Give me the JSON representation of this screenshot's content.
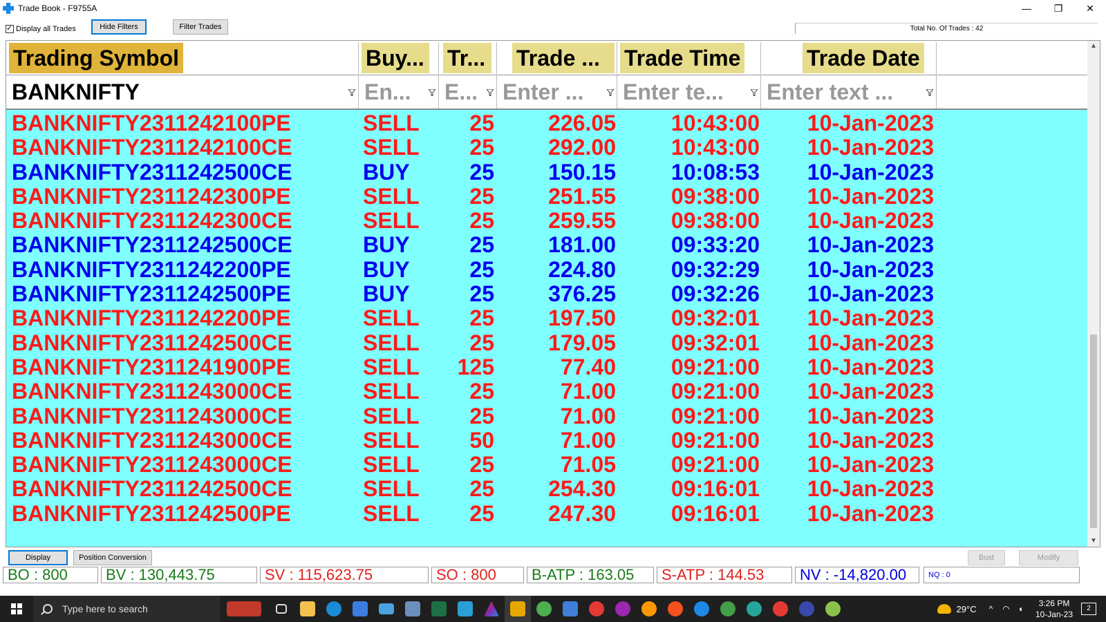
{
  "window": {
    "title": "Trade Book - F9755A",
    "minimize": "—",
    "restore": "❐",
    "close": "✕"
  },
  "toolbar": {
    "display_all_label": "Display all Trades",
    "hide_filters": "Hide Filters",
    "filter_trades": "Filter Trades",
    "total_trades": "Total No. Of Trades : 42"
  },
  "columns": [
    {
      "header": "Trading Symbol",
      "filter": "BANKNIFTY",
      "filter_is_value": true
    },
    {
      "header": "Buy...",
      "filter": "En...",
      "filter_is_value": false
    },
    {
      "header": "Tr...",
      "filter": "E...",
      "filter_is_value": false
    },
    {
      "header": "Trade ...",
      "filter": "Enter ...",
      "filter_is_value": false
    },
    {
      "header": "Trade Time",
      "filter": "Enter te...",
      "filter_is_value": false
    },
    {
      "header": "Trade Date",
      "filter": "Enter text ...",
      "filter_is_value": false
    }
  ],
  "trades": [
    {
      "symbol": "BANKNIFTY2311242100PE",
      "side": "SELL",
      "qty": "25",
      "price": "226.05",
      "time": "10:43:00",
      "date": "10-Jan-2023"
    },
    {
      "symbol": "BANKNIFTY2311242100CE",
      "side": "SELL",
      "qty": "25",
      "price": "292.00",
      "time": "10:43:00",
      "date": "10-Jan-2023"
    },
    {
      "symbol": "BANKNIFTY2311242500CE",
      "side": "BUY",
      "qty": "25",
      "price": "150.15",
      "time": "10:08:53",
      "date": "10-Jan-2023"
    },
    {
      "symbol": "BANKNIFTY2311242300PE",
      "side": "SELL",
      "qty": "25",
      "price": "251.55",
      "time": "09:38:00",
      "date": "10-Jan-2023"
    },
    {
      "symbol": "BANKNIFTY2311242300CE",
      "side": "SELL",
      "qty": "25",
      "price": "259.55",
      "time": "09:38:00",
      "date": "10-Jan-2023"
    },
    {
      "symbol": "BANKNIFTY2311242500CE",
      "side": "BUY",
      "qty": "25",
      "price": "181.00",
      "time": "09:33:20",
      "date": "10-Jan-2023"
    },
    {
      "symbol": "BANKNIFTY2311242200PE",
      "side": "BUY",
      "qty": "25",
      "price": "224.80",
      "time": "09:32:29",
      "date": "10-Jan-2023"
    },
    {
      "symbol": "BANKNIFTY2311242500PE",
      "side": "BUY",
      "qty": "25",
      "price": "376.25",
      "time": "09:32:26",
      "date": "10-Jan-2023"
    },
    {
      "symbol": "BANKNIFTY2311242200PE",
      "side": "SELL",
      "qty": "25",
      "price": "197.50",
      "time": "09:32:01",
      "date": "10-Jan-2023"
    },
    {
      "symbol": "BANKNIFTY2311242500CE",
      "side": "SELL",
      "qty": "25",
      "price": "179.05",
      "time": "09:32:01",
      "date": "10-Jan-2023"
    },
    {
      "symbol": "BANKNIFTY2311241900PE",
      "side": "SELL",
      "qty": "125",
      "price": "77.40",
      "time": "09:21:00",
      "date": "10-Jan-2023"
    },
    {
      "symbol": "BANKNIFTY2311243000CE",
      "side": "SELL",
      "qty": "25",
      "price": "71.00",
      "time": "09:21:00",
      "date": "10-Jan-2023"
    },
    {
      "symbol": "BANKNIFTY2311243000CE",
      "side": "SELL",
      "qty": "25",
      "price": "71.00",
      "time": "09:21:00",
      "date": "10-Jan-2023"
    },
    {
      "symbol": "BANKNIFTY2311243000CE",
      "side": "SELL",
      "qty": "50",
      "price": "71.00",
      "time": "09:21:00",
      "date": "10-Jan-2023"
    },
    {
      "symbol": "BANKNIFTY2311243000CE",
      "side": "SELL",
      "qty": "25",
      "price": "71.05",
      "time": "09:21:00",
      "date": "10-Jan-2023"
    },
    {
      "symbol": "BANKNIFTY2311242500CE",
      "side": "SELL",
      "qty": "25",
      "price": "254.30",
      "time": "09:16:01",
      "date": "10-Jan-2023"
    },
    {
      "symbol": "BANKNIFTY2311242500PE",
      "side": "SELL",
      "qty": "25",
      "price": "247.30",
      "time": "09:16:01",
      "date": "10-Jan-2023"
    }
  ],
  "bottom": {
    "display": "Display",
    "position_conversion": "Position Conversion",
    "bust": "Bust",
    "modify": "Modify"
  },
  "status": {
    "bo": "BO : 800",
    "bv": "BV : 130,443.75",
    "sv": "SV : 115,623.75",
    "so": "SO : 800",
    "batp": "B-ATP : 163.05",
    "satp": "S-ATP : 144.53",
    "nv": "NV : -14,820.00",
    "nq": "NQ : 0"
  },
  "taskbar": {
    "search_placeholder": "Type here to search",
    "temperature": "29°C",
    "time": "3:26 PM",
    "date": "10-Jan-23",
    "notifications": "2"
  },
  "colors": {
    "sell": "#ff1a1a",
    "buy": "#0000f0",
    "grid_bg": "#80ffff",
    "header_bg": "#e6dc8c",
    "status_green": "#1a7a1a",
    "status_red": "#e02020",
    "status_blue": "#0000e0"
  }
}
